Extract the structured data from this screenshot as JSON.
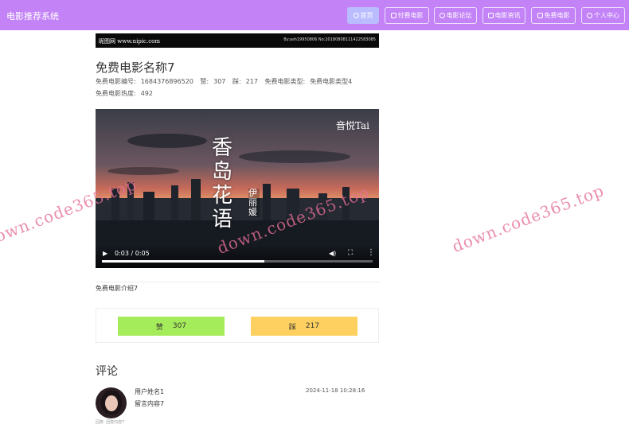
{
  "header": {
    "app_title": "电影推荐系统",
    "nav": [
      {
        "label": "首页",
        "icon": "home-icon",
        "active": true
      },
      {
        "label": "付费电影",
        "icon": "film-icon",
        "active": false
      },
      {
        "label": "电影论坛",
        "icon": "forum-icon",
        "active": false
      },
      {
        "label": "电影资讯",
        "icon": "news-icon",
        "active": false
      },
      {
        "label": "免费电影",
        "icon": "film-icon",
        "active": false
      },
      {
        "label": "个人中心",
        "icon": "user-icon",
        "active": false
      }
    ]
  },
  "banner": {
    "left_text": "昵图网 www.nipic.com",
    "right_text": "By:ash19950806 No:20180808111422583085"
  },
  "movie": {
    "title": "免费电影名称7",
    "number_label": "免费电影编号:",
    "number": "1684376896520",
    "like_label": "赞:",
    "like_count": "307",
    "dislike_label": "踩:",
    "dislike_count": "217",
    "type_label": "免费电影类型:",
    "type": "免费电影类型4",
    "heat_label": "免费电影热度:",
    "heat": "492",
    "intro": "免费电影介绍7"
  },
  "video": {
    "watermark": "音悦Tai",
    "song_title": "香岛花语",
    "singer": "伊丽媛",
    "time": "0:03 / 0:05",
    "progress": 0.6
  },
  "votes": {
    "like_label": "赞",
    "like_count": "307",
    "dislike_label": "踩",
    "dislike_count": "217"
  },
  "comments": {
    "heading": "评论",
    "items": [
      {
        "user": "用户姓名1",
        "time": "2024-11-18 10:28:16",
        "content": "留言内容7",
        "reply": "回复: 回复内容7"
      }
    ]
  },
  "watermark_text": "down.code365.top",
  "colors": {
    "header": "#c383f7",
    "nav_active": "#b9bcff",
    "like": "#a5ec5b",
    "dislike": "#fdd05f",
    "watermark": "#e66e96"
  }
}
